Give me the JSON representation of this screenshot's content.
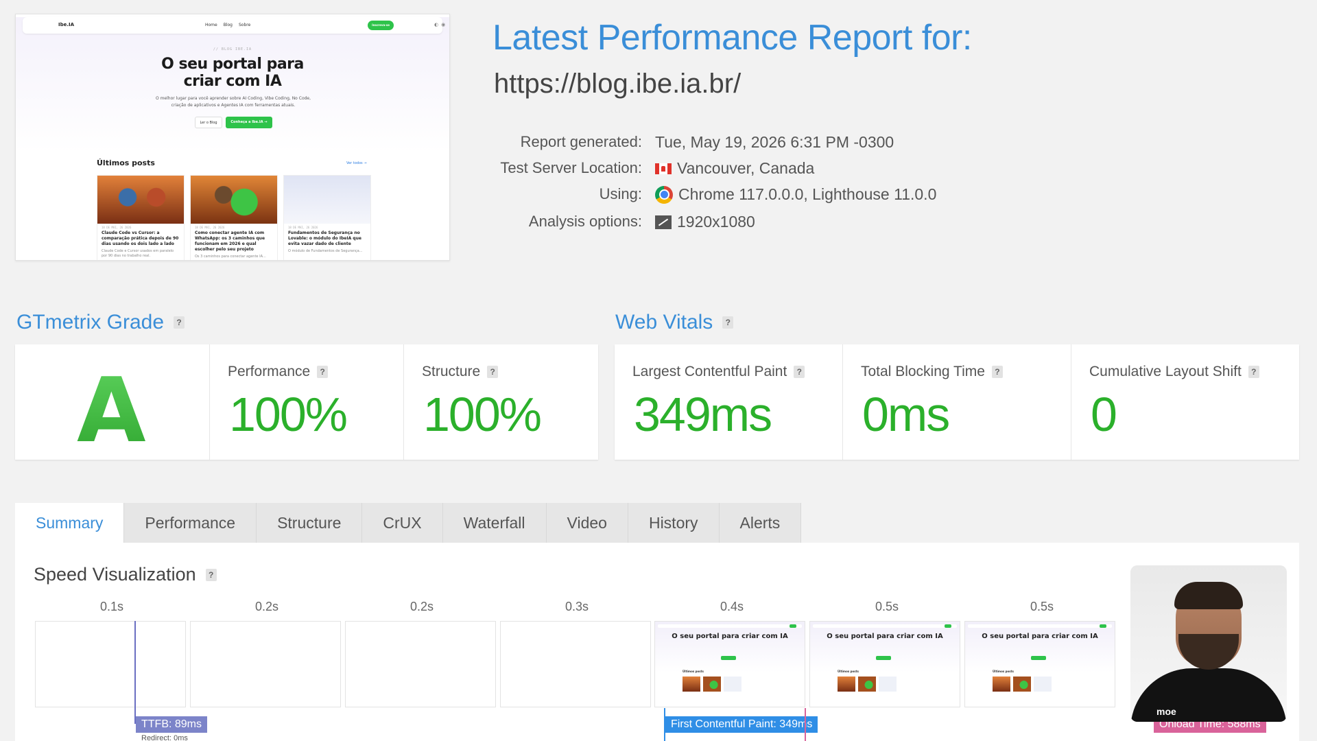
{
  "thumbnail": {
    "logo": "Ibe.IA",
    "nav_links": [
      "Home",
      "Blog",
      "Sobre"
    ],
    "nav_cta": "Inscreva-se",
    "kicker": "// BLOG IBE.IA",
    "hero_line1": "O seu portal para",
    "hero_line2": "criar com IA",
    "subtitle": "O melhor lugar para você aprender sobre AI Coding, Vibe Coding, No Code, criação de aplicativos e Agentes IA com ferramentas atuais.",
    "btn_blog": "Ler o Blog",
    "btn_cta": "Conheça a Ibe.IA →",
    "posts_title": "Últimos posts",
    "view_all": "Ver todos →",
    "posts": [
      {
        "date": "18 DE MAI, 26 2026",
        "title": "Claude Code vs Cursor: a comparação prática depois de 90 dias usando os dois lado a lado",
        "excerpt": "Claude Code e Cursor usados em paralelo por 90 dias no trabalho real."
      },
      {
        "date": "18 DE MAI, 26 2026",
        "title": "Como conectar agente IA com WhatsApp: os 3 caminhos que funcionam em 2026 e qual escolher pelo seu projeto",
        "excerpt": "Os 3 caminhos para conectar agente IA..."
      },
      {
        "date": "18 DE MAI, 26 2026",
        "title": "Fundamentos de Segurança no Lovable: o módulo do IbeIA que evita vazar dado de cliente",
        "excerpt": "O módulo de Fundamentos de Segurança..."
      }
    ]
  },
  "report": {
    "title": "Latest Performance Report for:",
    "url": "https://blog.ibe.ia.br/",
    "meta": [
      {
        "label": "Report generated:",
        "value": "Tue, May 19, 2026 6:31 PM -0300",
        "icon": ""
      },
      {
        "label": "Test Server Location:",
        "value": "Vancouver, Canada",
        "icon": "canada-flag-icon"
      },
      {
        "label": "Using:",
        "value": "Chrome 117.0.0.0, Lighthouse 11.0.0",
        "icon": "chrome-icon"
      },
      {
        "label": "Analysis options:",
        "value": "1920x1080",
        "icon": "resolution-icon"
      }
    ]
  },
  "grade": {
    "section_title": "GTmetrix Grade",
    "letter": "A",
    "performance_label": "Performance",
    "performance_value": "100%",
    "structure_label": "Structure",
    "structure_value": "100%"
  },
  "vitals": {
    "section_title": "Web Vitals",
    "lcp_label": "Largest Contentful Paint",
    "lcp_value": "349ms",
    "tbt_label": "Total Blocking Time",
    "tbt_value": "0ms",
    "cls_label": "Cumulative Layout Shift",
    "cls_value": "0"
  },
  "help_glyph": "?",
  "tabs": [
    "Summary",
    "Performance",
    "Structure",
    "CrUX",
    "Waterfall",
    "Video",
    "History",
    "Alerts"
  ],
  "active_tab": "Summary",
  "speed": {
    "title": "Speed Visualization",
    "ticks": [
      "0.1s",
      "0.2s",
      "0.2s",
      "0.3s",
      "0.4s",
      "0.5s",
      "0.5s"
    ],
    "ttfb_badge": "TTFB: 89ms",
    "ttfb_subtext": "Redirect: 0ms",
    "fcp_badge": "First Contentful Paint: 349ms",
    "onload_badge": "Onload Time: 588ms",
    "frame_text": "O seu portal para criar com IA",
    "frame_posts": "Últimos posts"
  },
  "webcam": {
    "shirt_logo": "moe"
  },
  "colors": {
    "accent": "#3a8ed8",
    "good": "#2bb02b",
    "ttfb": "#7c84c9",
    "fcp": "#2f8ee6",
    "onload": "#d9639a"
  }
}
